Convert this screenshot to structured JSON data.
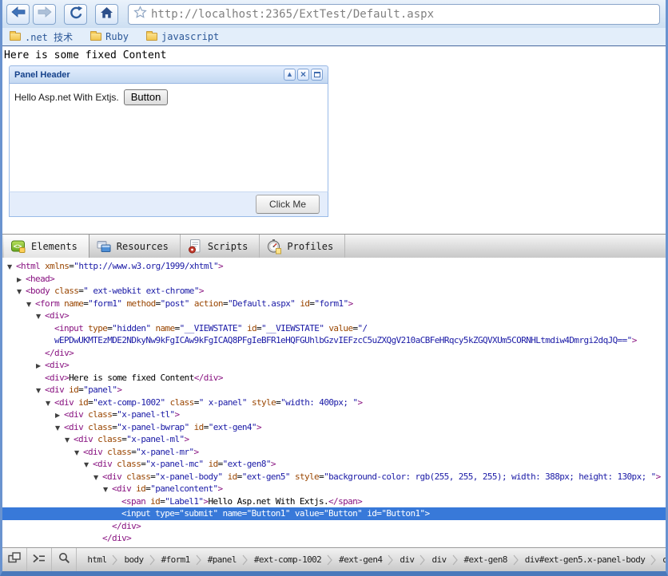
{
  "browser": {
    "url": "http://localhost:2365/ExtTest/Default.aspx",
    "bookmarks": [
      ".net 技术",
      "Ruby",
      "javascript"
    ]
  },
  "page": {
    "fixed_content": "Here is some fixed Content",
    "panel": {
      "header": "Panel Header",
      "label": "Hello Asp.net With Extjs.",
      "button": "Button",
      "footer_button": "Click Me"
    }
  },
  "icons": {
    "panel_collapse": "▲",
    "panel_close": "×"
  },
  "devtools": {
    "tabs": [
      {
        "id": "elements",
        "label": "Elements",
        "selected": true
      },
      {
        "id": "resources",
        "label": "Resources",
        "selected": false
      },
      {
        "id": "scripts",
        "label": "Scripts",
        "selected": false
      },
      {
        "id": "profiles",
        "label": "Profiles",
        "selected": false
      }
    ],
    "colors": {
      "selection": "#3879d9",
      "tag": "#881280",
      "attr_name": "#994500",
      "attr_value": "#1a1aa6",
      "panel_header_text": "#15428b"
    },
    "tree": [
      {
        "i": 0,
        "a": "open",
        "p": [
          [
            "g",
            "<html"
          ],
          [
            "a",
            " xmlns"
          ],
          [
            "p",
            "="
          ],
          [
            "v",
            "\"http://www.w3.org/1999/xhtml\""
          ],
          [
            "g",
            ">"
          ]
        ]
      },
      {
        "i": 1,
        "a": "closed",
        "p": [
          [
            "g",
            "<head>"
          ]
        ]
      },
      {
        "i": 1,
        "a": "open",
        "p": [
          [
            "g",
            "<body"
          ],
          [
            "a",
            " class"
          ],
          [
            "p",
            "="
          ],
          [
            "v",
            "\" ext-webkit ext-chrome\""
          ],
          [
            "g",
            ">"
          ]
        ]
      },
      {
        "i": 2,
        "a": "open",
        "p": [
          [
            "g",
            "<form"
          ],
          [
            "a",
            " name"
          ],
          [
            "p",
            "="
          ],
          [
            "v",
            "\"form1\""
          ],
          [
            "a",
            " method"
          ],
          [
            "p",
            "="
          ],
          [
            "v",
            "\"post\""
          ],
          [
            "a",
            " action"
          ],
          [
            "p",
            "="
          ],
          [
            "v",
            "\"Default.aspx\""
          ],
          [
            "a",
            " id"
          ],
          [
            "p",
            "="
          ],
          [
            "v",
            "\"form1\""
          ],
          [
            "g",
            ">"
          ]
        ]
      },
      {
        "i": 3,
        "a": "open",
        "p": [
          [
            "g",
            "<div>"
          ]
        ]
      },
      {
        "i": 4,
        "a": "none",
        "p": [
          [
            "g",
            "<input"
          ],
          [
            "a",
            " type"
          ],
          [
            "p",
            "="
          ],
          [
            "v",
            "\"hidden\""
          ],
          [
            "a",
            " name"
          ],
          [
            "p",
            "="
          ],
          [
            "v",
            "\"__VIEWSTATE\""
          ],
          [
            "a",
            " id"
          ],
          [
            "p",
            "="
          ],
          [
            "v",
            "\"__VIEWSTATE\""
          ],
          [
            "a",
            " value"
          ],
          [
            "p",
            "="
          ],
          [
            "v",
            "\"/"
          ]
        ]
      },
      {
        "i": 4,
        "a": "none",
        "p": [
          [
            "v",
            "wEPDwUKMTEzMDE2NDkyNw9kFgICAw9kFgICAQ8PFgIeBFR1eHQFGUhlbGzvIEFzcC5uZXQgV210aCBFeHRqcy5kZGQVXUm5CORNHLtmdiw4Dmrgi2dqJQ==\""
          ],
          [
            "g",
            ">"
          ]
        ]
      },
      {
        "i": 3,
        "a": "none",
        "p": [
          [
            "g",
            "</div>"
          ]
        ]
      },
      {
        "i": 3,
        "a": "closed",
        "p": [
          [
            "g",
            "<div>"
          ]
        ]
      },
      {
        "i": 3,
        "a": "none",
        "p": [
          [
            "g",
            "<div>"
          ],
          [
            "t",
            "Here is some fixed Content"
          ],
          [
            "g",
            "</div>"
          ]
        ]
      },
      {
        "i": 3,
        "a": "open",
        "p": [
          [
            "g",
            "<div"
          ],
          [
            "a",
            " id"
          ],
          [
            "p",
            "="
          ],
          [
            "v",
            "\"panel\""
          ],
          [
            "g",
            ">"
          ]
        ]
      },
      {
        "i": 4,
        "a": "open",
        "p": [
          [
            "g",
            "<div"
          ],
          [
            "a",
            " id"
          ],
          [
            "p",
            "="
          ],
          [
            "v",
            "\"ext-comp-1002\""
          ],
          [
            "a",
            " class"
          ],
          [
            "p",
            "="
          ],
          [
            "v",
            "\" x-panel\""
          ],
          [
            "a",
            " style"
          ],
          [
            "p",
            "="
          ],
          [
            "v",
            "\"width: 400px; \""
          ],
          [
            "g",
            ">"
          ]
        ]
      },
      {
        "i": 5,
        "a": "closed",
        "p": [
          [
            "g",
            "<div"
          ],
          [
            "a",
            " class"
          ],
          [
            "p",
            "="
          ],
          [
            "v",
            "\"x-panel-tl\""
          ],
          [
            "g",
            ">"
          ]
        ]
      },
      {
        "i": 5,
        "a": "open",
        "p": [
          [
            "g",
            "<div"
          ],
          [
            "a",
            " class"
          ],
          [
            "p",
            "="
          ],
          [
            "v",
            "\"x-panel-bwrap\""
          ],
          [
            "a",
            " id"
          ],
          [
            "p",
            "="
          ],
          [
            "v",
            "\"ext-gen4\""
          ],
          [
            "g",
            ">"
          ]
        ]
      },
      {
        "i": 6,
        "a": "open",
        "p": [
          [
            "g",
            "<div"
          ],
          [
            "a",
            " class"
          ],
          [
            "p",
            "="
          ],
          [
            "v",
            "\"x-panel-ml\""
          ],
          [
            "g",
            ">"
          ]
        ]
      },
      {
        "i": 7,
        "a": "open",
        "p": [
          [
            "g",
            "<div"
          ],
          [
            "a",
            " class"
          ],
          [
            "p",
            "="
          ],
          [
            "v",
            "\"x-panel-mr\""
          ],
          [
            "g",
            ">"
          ]
        ]
      },
      {
        "i": 8,
        "a": "open",
        "p": [
          [
            "g",
            "<div"
          ],
          [
            "a",
            " class"
          ],
          [
            "p",
            "="
          ],
          [
            "v",
            "\"x-panel-mc\""
          ],
          [
            "a",
            " id"
          ],
          [
            "p",
            "="
          ],
          [
            "v",
            "\"ext-gen8\""
          ],
          [
            "g",
            ">"
          ]
        ]
      },
      {
        "i": 9,
        "a": "open",
        "p": [
          [
            "g",
            "<div"
          ],
          [
            "a",
            " class"
          ],
          [
            "p",
            "="
          ],
          [
            "v",
            "\"x-panel-body\""
          ],
          [
            "a",
            " id"
          ],
          [
            "p",
            "="
          ],
          [
            "v",
            "\"ext-gen5\""
          ],
          [
            "a",
            " style"
          ],
          [
            "p",
            "="
          ],
          [
            "v",
            "\"background-color: rgb(255, 255, 255); width: 388px; height: 130px; \""
          ],
          [
            "g",
            ">"
          ]
        ]
      },
      {
        "i": 10,
        "a": "open",
        "p": [
          [
            "g",
            "<div"
          ],
          [
            "a",
            " id"
          ],
          [
            "p",
            "="
          ],
          [
            "v",
            "\"panelcontent\""
          ],
          [
            "g",
            ">"
          ]
        ]
      },
      {
        "i": 11,
        "a": "none",
        "p": [
          [
            "g",
            "<span"
          ],
          [
            "a",
            " id"
          ],
          [
            "p",
            "="
          ],
          [
            "v",
            "\"Label1\""
          ],
          [
            "g",
            ">"
          ],
          [
            "t",
            "Hello Asp.net With Extjs."
          ],
          [
            "g",
            "</span>"
          ]
        ]
      },
      {
        "i": 11,
        "a": "none",
        "sel": true,
        "p": [
          [
            "g",
            "<input"
          ],
          [
            "a",
            " type"
          ],
          [
            "p",
            "="
          ],
          [
            "v",
            "\"submit\""
          ],
          [
            "a",
            " name"
          ],
          [
            "p",
            "="
          ],
          [
            "v",
            "\"Button1\""
          ],
          [
            "a",
            " value"
          ],
          [
            "p",
            "="
          ],
          [
            "v",
            "\"Button\""
          ],
          [
            "a",
            " id"
          ],
          [
            "p",
            "="
          ],
          [
            "v",
            "\"Button1\""
          ],
          [
            "g",
            ">"
          ]
        ]
      },
      {
        "i": 10,
        "a": "none",
        "p": [
          [
            "g",
            "</div>"
          ]
        ]
      },
      {
        "i": 9,
        "a": "none",
        "p": [
          [
            "g",
            "</div>"
          ]
        ]
      }
    ],
    "breadcrumbs": [
      "html",
      "body",
      "#form1",
      "#panel",
      "#ext-comp-1002",
      "#ext-gen4",
      "div",
      "div",
      "#ext-gen8",
      "div#ext-gen5.x-panel-body",
      "div"
    ]
  }
}
